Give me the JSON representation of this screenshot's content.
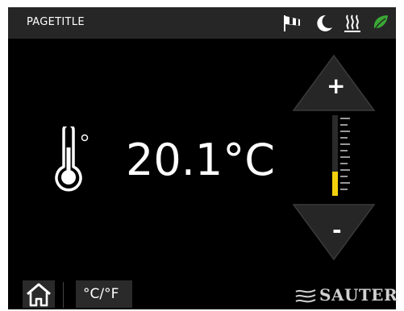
{
  "header": {
    "title": "PAGETITLE",
    "icons": [
      "flag-icon",
      "moon-icon",
      "heating-icon",
      "leaf-icon"
    ]
  },
  "main": {
    "temperature": "20.1°C",
    "increase_label": "+",
    "decrease_label": "-",
    "setpoint_level": 0.3
  },
  "footer": {
    "unit_toggle": "°C/°F",
    "brand": "SAUTER"
  },
  "colors": {
    "accent": "#f3d20b",
    "eco": "#3aa835",
    "background": "#000000",
    "header": "#262626"
  }
}
